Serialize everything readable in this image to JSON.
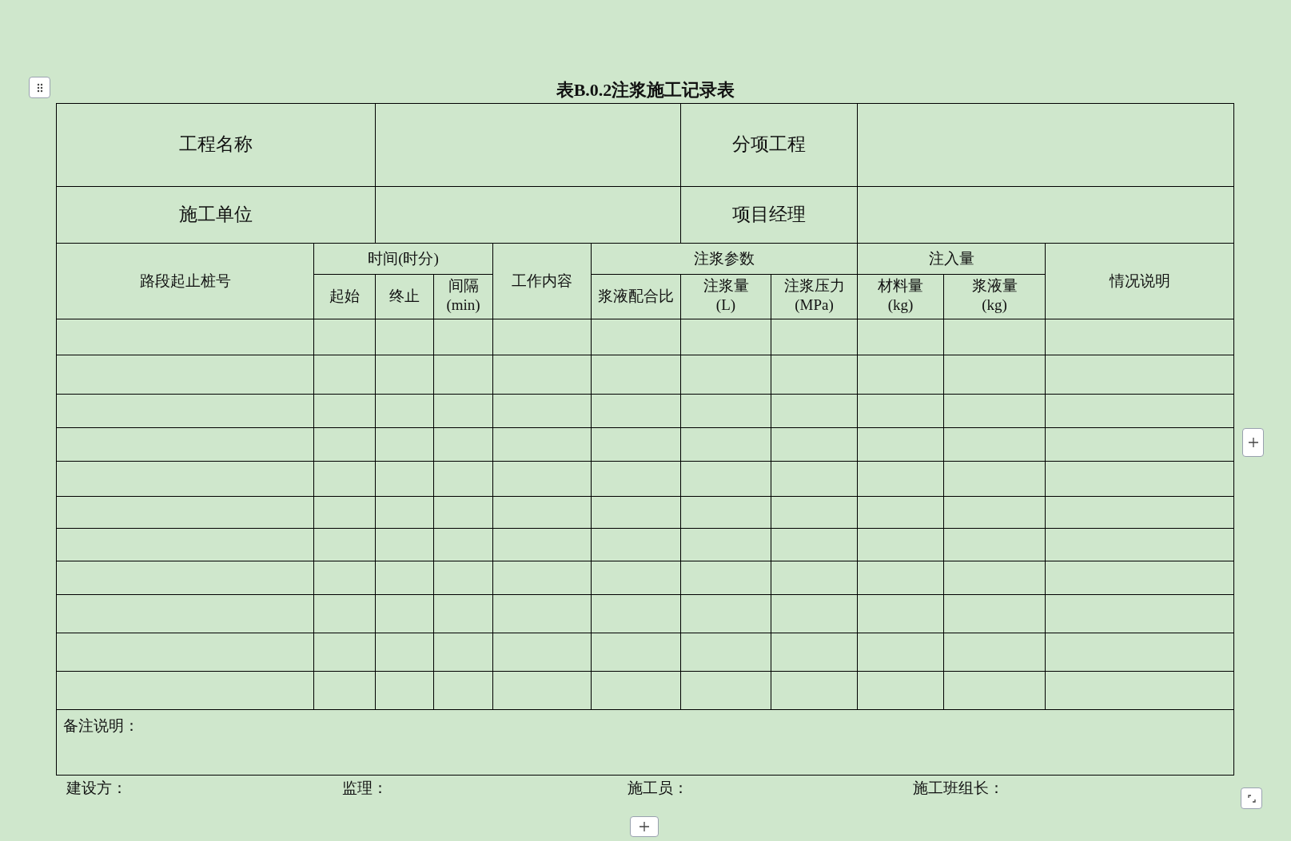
{
  "title": "表B.0.2注浆施工记录表",
  "info_rows": [
    {
      "cells": [
        "工程名称",
        "分项工程"
      ]
    },
    {
      "cells": [
        "施工单位",
        "项目经理"
      ]
    }
  ],
  "header": {
    "station": "路段起止桩号",
    "time": {
      "label": "时间(时分)",
      "columns": [
        [
          "起始"
        ],
        [
          "终止"
        ],
        [
          "间隔",
          "(min)"
        ]
      ]
    },
    "work": "工作内容",
    "grouting": {
      "label": "注浆参数",
      "columns": [
        [
          "浆液配合比"
        ],
        [
          "注浆量",
          "(L)"
        ],
        [
          "注浆压力",
          "(MPa)"
        ]
      ]
    },
    "injection": {
      "label": "注入量",
      "columns": [
        [
          "材料量",
          "(kg)"
        ],
        [
          "浆液量",
          "(kg)"
        ]
      ]
    },
    "notes": "情况说明"
  },
  "remarks": "备注说明：",
  "signatures": [
    "建设方：",
    "监理：",
    "施工员：",
    "施工班组长："
  ]
}
